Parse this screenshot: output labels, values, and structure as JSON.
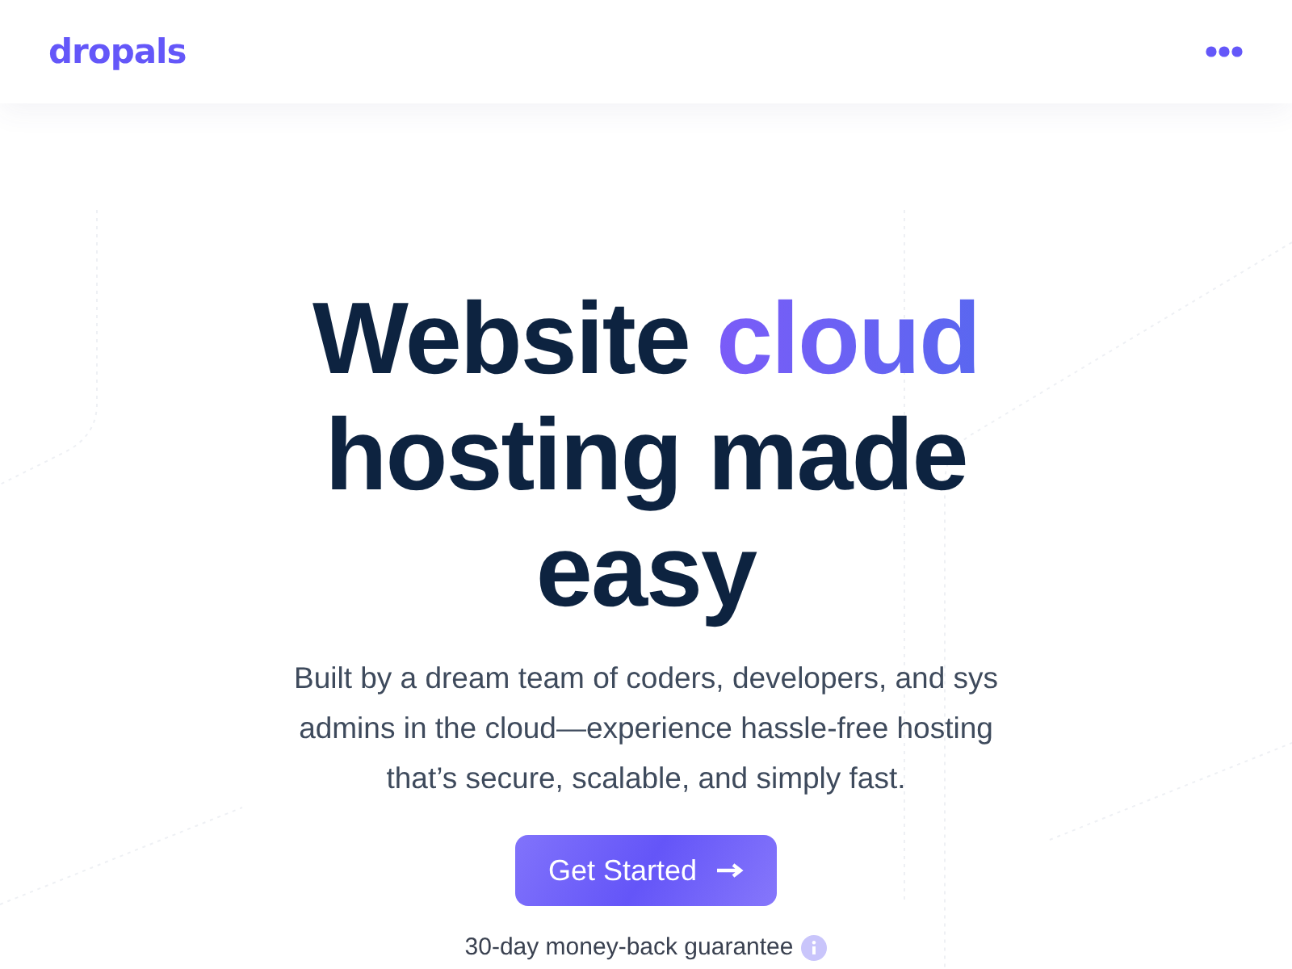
{
  "header": {
    "logo": "dropals"
  },
  "hero": {
    "headline": {
      "before": "Website",
      "accent": "cloud",
      "after": "hosting made easy"
    },
    "description": "Built by a dream team of coders, developers, and sys admins in the cloud—experience hassle-free hosting that’s secure, scalable, and simply fast.",
    "cta": {
      "label": "Get Started"
    },
    "guarantee": "30-day money-back guarantee"
  }
}
